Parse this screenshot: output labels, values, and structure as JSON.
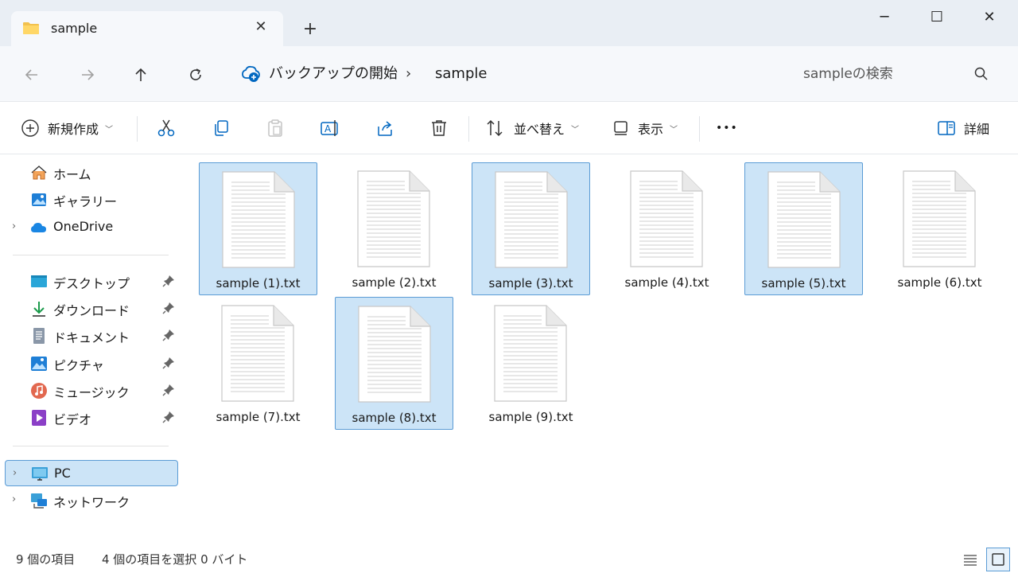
{
  "window": {
    "tab_title": "sample",
    "tab_close": "✕",
    "new_tab": "+",
    "minimize": "─",
    "maximize": "☐",
    "close": "✕"
  },
  "nav": {
    "breadcrumb": [
      "バックアップの開始",
      "sample"
    ],
    "separator": "›",
    "search_placeholder": "sampleの検索"
  },
  "toolbar": {
    "new_label": "新規作成",
    "sort_label": "並べ替え",
    "view_label": "表示",
    "more_label": "•••",
    "details_label": "詳細"
  },
  "sidebar": {
    "top_items": [
      {
        "label": "ホーム",
        "icon": "home-icon"
      },
      {
        "label": "ギャラリー",
        "icon": "gallery-icon"
      },
      {
        "label": "OneDrive",
        "icon": "onedrive-icon"
      }
    ],
    "quick_access": [
      {
        "label": "デスクトップ",
        "icon": "desktop-icon"
      },
      {
        "label": "ダウンロード",
        "icon": "download-icon"
      },
      {
        "label": "ドキュメント",
        "icon": "documents-icon"
      },
      {
        "label": "ピクチャ",
        "icon": "pictures-icon"
      },
      {
        "label": "ミュージック",
        "icon": "music-icon"
      },
      {
        "label": "ビデオ",
        "icon": "videos-icon"
      }
    ],
    "bottom_items": [
      {
        "label": "PC",
        "icon": "pc-icon",
        "selected": true
      },
      {
        "label": "ネットワーク",
        "icon": "network-icon",
        "selected": false
      }
    ]
  },
  "files": [
    {
      "name": "sample (1).txt",
      "selected": true
    },
    {
      "name": "sample (2).txt",
      "selected": false
    },
    {
      "name": "sample (3).txt",
      "selected": true
    },
    {
      "name": "sample (4).txt",
      "selected": false
    },
    {
      "name": "sample (5).txt",
      "selected": true
    },
    {
      "name": "sample (6).txt",
      "selected": false
    },
    {
      "name": "sample (7).txt",
      "selected": false
    },
    {
      "name": "sample (8).txt",
      "selected": true
    },
    {
      "name": "sample (9).txt",
      "selected": false
    }
  ],
  "status": {
    "item_count": "9 個の項目",
    "selection": "4 個の項目を選択  0 バイト"
  },
  "colors": {
    "selection_bg": "#cce4f7",
    "selection_border": "#5a9bd5",
    "accent": "#0067c0"
  }
}
